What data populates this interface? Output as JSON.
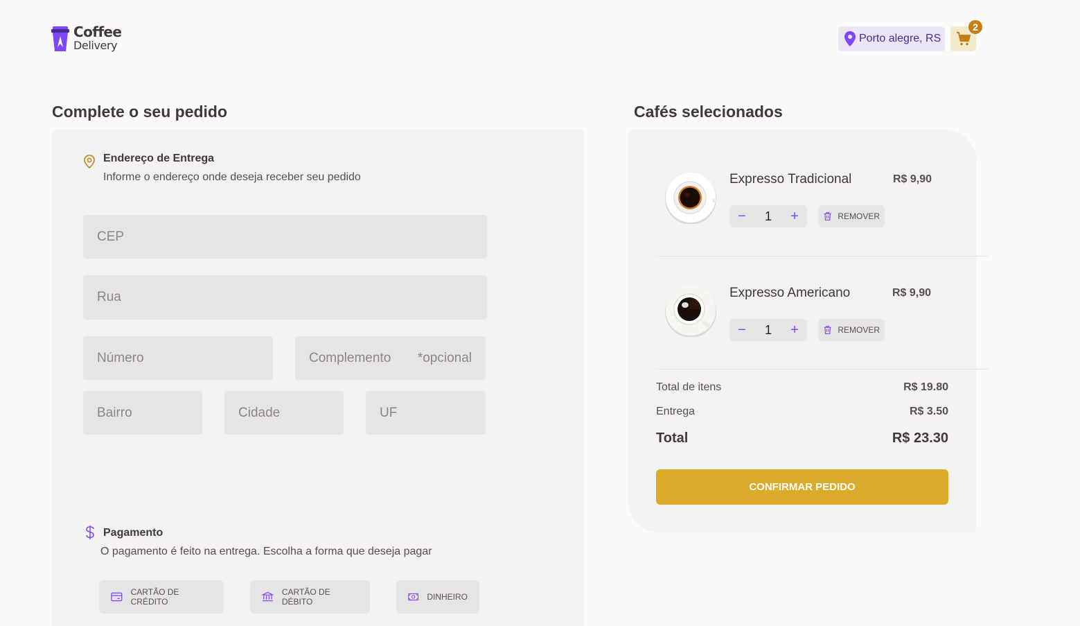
{
  "header": {
    "logo_line1": "Coffee",
    "logo_line2": "Delivery",
    "location": "Porto alegre, RS",
    "cart_count": "2"
  },
  "checkout": {
    "title": "Complete o seu pedido",
    "address": {
      "title": "Endereço de Entrega",
      "subtitle": "Informe o endereço onde deseja receber seu pedido",
      "fields": {
        "cep": "CEP",
        "rua": "Rua",
        "numero": "Número",
        "complemento": "Complemento",
        "complemento_hint": "*opcional",
        "bairro": "Bairro",
        "cidade": "Cidade",
        "uf": "UF"
      }
    },
    "payment": {
      "title": "Pagamento",
      "subtitle": "O pagamento é feito na entrega. Escolha a forma que deseja pagar",
      "options": [
        "CARTÃO DE CRÉDITO",
        "CARTÃO DE DÉBITO",
        "DINHEIRO"
      ]
    }
  },
  "cart": {
    "title": "Cafés selecionados",
    "items": [
      {
        "name": "Expresso Tradicional",
        "price": "R$ 9,90",
        "quantity": "1",
        "remove_label": "REMOVER"
      },
      {
        "name": "Expresso Americano",
        "price": "R$ 9,90",
        "quantity": "1",
        "remove_label": "REMOVER"
      }
    ],
    "summary": {
      "items_label": "Total de itens",
      "items_value": "R$ 19.80",
      "delivery_label": "Entrega",
      "delivery_value": "R$ 3.50",
      "total_label": "Total",
      "total_value": "R$ 23.30"
    },
    "confirm_label": "CONFIRMAR PEDIDO"
  },
  "colors": {
    "purple": "#8047f8",
    "purple_dark": "#4b2995",
    "yellow": "#dbac2c",
    "yellow_dark": "#c47f17",
    "card_bg": "#f3f2f2",
    "input_bg": "#e6e5e5"
  },
  "icons": [
    "cup-logo-icon",
    "map-pin-icon",
    "cart-icon",
    "dollar-icon",
    "credit-card-icon",
    "bank-icon",
    "money-icon",
    "minus-icon",
    "plus-icon",
    "trash-icon"
  ]
}
